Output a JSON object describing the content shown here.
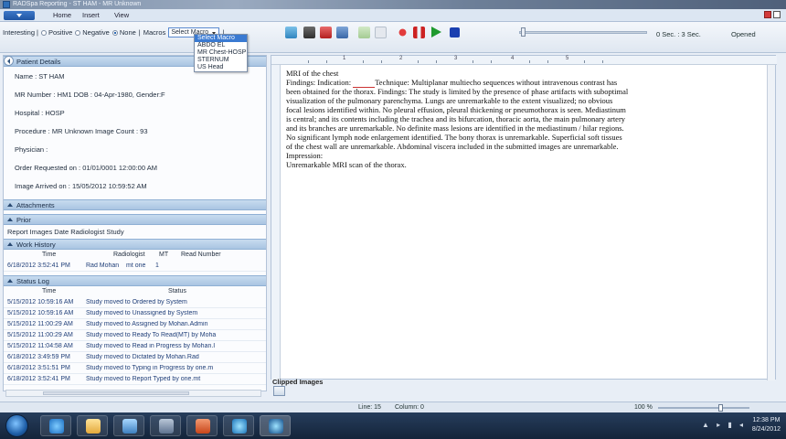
{
  "window": {
    "title": "RADSpa Reporting - ST HAM - MR Unknown"
  },
  "ribbon": {
    "tabs": [
      "Home",
      "Insert",
      "View"
    ]
  },
  "toolbar": {
    "flags": {
      "interesting": "Interesting",
      "positive": "Positive",
      "negative": "Negative",
      "none": "None",
      "selected": "None"
    },
    "macros_label": "Macros",
    "macro_selected": "Select Macro",
    "macro_options": [
      "Select Macro",
      "ABDO EL",
      "MR Chest-HOSP",
      "STERNUM",
      "US Head"
    ],
    "audio_time": "0 Sec. : 3 Sec.",
    "audio_status": "Opened"
  },
  "patient": {
    "header": "Patient Details",
    "name": "Name : ST HAM",
    "mr_line": "MR Number : HM1  DOB : 04-Apr-1980, Gender:F",
    "hospital": "Hospital : HOSP",
    "procedure": "Procedure : MR Unknown Image Count : 93",
    "physician": "Physician :",
    "order_requested": "Order Requested on : 01/01/0001 12:00:00 AM",
    "image_arrived": "Image Arrived on : 15/05/2012 10:59:52 AM"
  },
  "attachments": {
    "header": "Attachments"
  },
  "prior": {
    "header": "Prior",
    "columns": "Report Images Date Radiologist Study"
  },
  "work_history": {
    "header": "Work History",
    "columns": [
      "Time",
      "Radiologist",
      "MT",
      "Read Number"
    ],
    "rows": [
      {
        "time": "6/18/2012 3:52:41 PM",
        "radiologist": "Rad Mohan",
        "mt": "mt one",
        "read": "1"
      }
    ]
  },
  "status_log": {
    "header": "Status Log",
    "columns": [
      "Time",
      "Status"
    ],
    "rows": [
      {
        "time": "5/15/2012 10:59:16 AM",
        "status": "Study moved to Ordered by System"
      },
      {
        "time": "5/15/2012 10:59:16 AM",
        "status": "Study moved to Unassigned by System"
      },
      {
        "time": "5/15/2012 11:00:29 AM",
        "status": "Study moved to Assigned by Mohan.Admin"
      },
      {
        "time": "5/15/2012 11:00:29 AM",
        "status": "Study moved to Ready To Read(MT) by Moha"
      },
      {
        "time": "5/15/2012 11:04:58 AM",
        "status": "Study moved to Read in Progress by Mohan.I"
      },
      {
        "time": "6/18/2012 3:49:59 PM",
        "status": "Study moved to Dictated by Mohan.Rad"
      },
      {
        "time": "6/18/2012 3:51:51 PM",
        "status": "Study moved to Typing in Progress by one.m"
      },
      {
        "time": "6/18/2012 3:52:41 PM",
        "status": "Study moved to Report Typed by one.mt"
      }
    ]
  },
  "report": {
    "title": "MRI of the chest",
    "indication_label": "Findings: Indication:",
    "technique": "Technique: Multiplanar multiecho sequences without intravenous contrast has been obtained for the thorax.  Findings: The study is limited by the presence of phase artifacts with suboptimal visualization of the pulmonary parenchyma.  Lungs are unremarkable to the extent visualized; no obvious focal lesions identified within. No pleural effusion, pleural thickening or pneumothorax is seen.  Mediastinum is central; and its contents including the trachea and its bifurcation, thoracic aorta, the main pulmonary artery and its branches are unremarkable.  No definite mass lesions are identified in the mediastinum / hilar regions. No significant lymph node enlargement identified. The bony thorax is unremarkable. Superficial soft tissues of the chest wall are unremarkable. Abdominal viscera included in the submitted images are unremarkable.",
    "impression_label": "Impression:",
    "impression": "Unremarkable MRI scan of the thorax.",
    "ruler_marks": [
      "1",
      "2",
      "3",
      "4",
      "5"
    ]
  },
  "clipped": {
    "label": "Clipped Images"
  },
  "status": {
    "line": "Line: 15",
    "column": "Column: 0",
    "zoom": "100 %"
  },
  "clock": {
    "time": "12:38 PM",
    "date": "8/24/2012"
  },
  "colors": {
    "accent": "#3a7ad2",
    "header_bg": "#a9c5e2",
    "taskbar": "#1b2e48"
  }
}
